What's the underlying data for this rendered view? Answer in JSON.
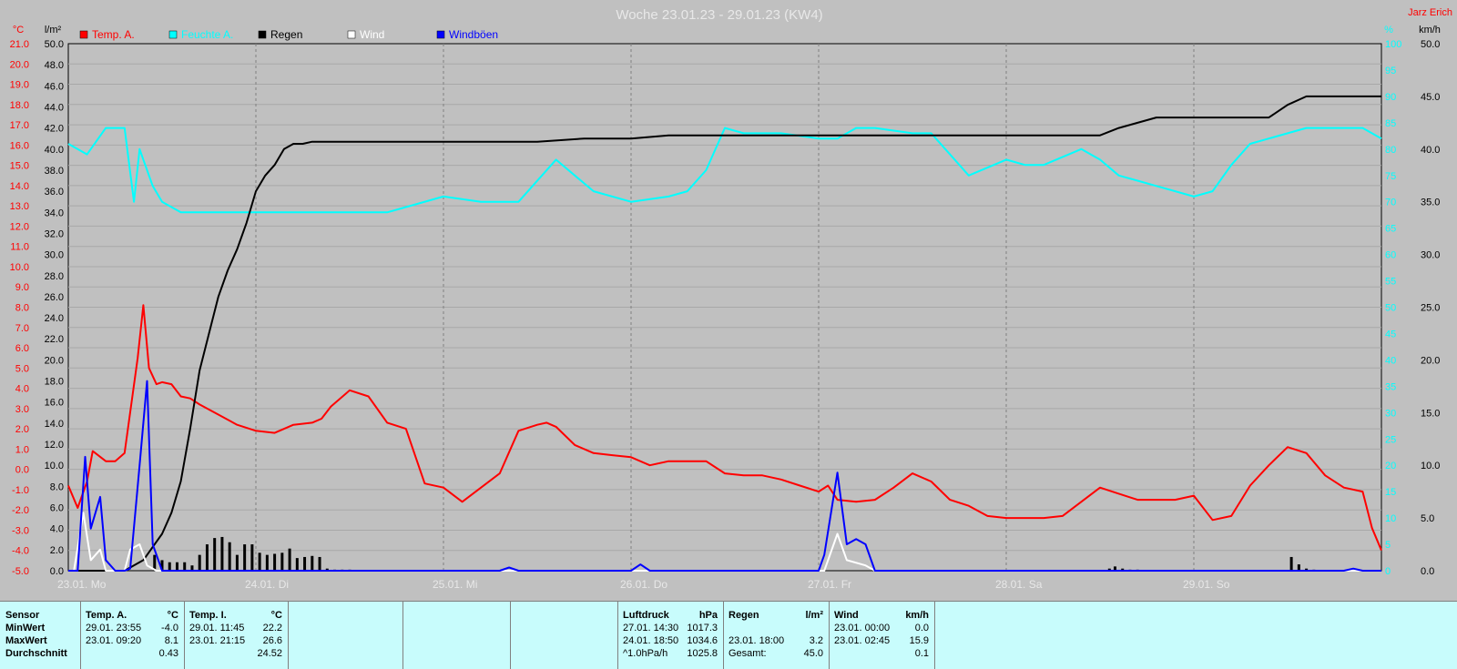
{
  "chart_data": {
    "type": "line",
    "title": "Woche 23.01.23 - 29.01.23 (KW4)",
    "author": "Jarz Erich",
    "axes": {
      "temp": {
        "unit": "°C",
        "range": [
          -5.0,
          21.0
        ],
        "ticks": [
          "21.0",
          "20.0",
          "19.0",
          "18.0",
          "17.0",
          "16.0",
          "15.0",
          "14.0",
          "13.0",
          "12.0",
          "11.0",
          "10.0",
          "9.0",
          "8.0",
          "7.0",
          "6.0",
          "5.0",
          "4.0",
          "3.0",
          "2.0",
          "1.0",
          "0.0",
          "-1.0",
          "-2.0",
          "-3.0",
          "-4.0",
          "-5.0"
        ],
        "color": "#ff0000"
      },
      "rain": {
        "unit": "l/m²",
        "range": [
          0.0,
          50.0
        ],
        "ticks": [
          "50.0",
          "48.0",
          "46.0",
          "44.0",
          "42.0",
          "40.0",
          "38.0",
          "36.0",
          "34.0",
          "32.0",
          "30.0",
          "28.0",
          "26.0",
          "24.0",
          "22.0",
          "20.0",
          "18.0",
          "16.0",
          "14.0",
          "12.0",
          "10.0",
          "8.0",
          "6.0",
          "4.0",
          "2.0",
          "0.0"
        ],
        "color": "#000000"
      },
      "humidity": {
        "unit": "%",
        "range": [
          0,
          100
        ],
        "ticks": [
          "100",
          "95",
          "90",
          "85",
          "80",
          "75",
          "70",
          "65",
          "60",
          "55",
          "50",
          "45",
          "40",
          "35",
          "30",
          "25",
          "20",
          "15",
          "10",
          "5",
          "0"
        ],
        "color": "#00ffff"
      },
      "wind": {
        "unit": "km/h",
        "range": [
          0.0,
          50.0
        ],
        "ticks": [
          "50.0",
          "45.0",
          "40.0",
          "35.0",
          "30.0",
          "25.0",
          "20.0",
          "15.0",
          "10.0",
          "5.0",
          "0.0"
        ],
        "color": "#000000"
      }
    },
    "x_range_days": [
      0,
      7
    ],
    "x_labels": [
      "23.01. Mo",
      "24.01. Di",
      "25.01. Mi",
      "26.01. Do",
      "27.01. Fr",
      "28.01. Sa",
      "29.01. So"
    ],
    "legend": [
      {
        "name": "Temp. A.",
        "color": "#ff0000"
      },
      {
        "name": "Feuchte A.",
        "color": "#00ffff"
      },
      {
        "name": "Regen",
        "color": "#000000"
      },
      {
        "name": "Wind",
        "color": "#ffffff"
      },
      {
        "name": "Windböen",
        "color": "#0000ff"
      }
    ],
    "grid": true,
    "series": [
      {
        "name": "Temp. A.",
        "axis": "temp",
        "color": "#ff0000",
        "x": [
          0.0,
          0.05,
          0.1,
          0.13,
          0.2,
          0.25,
          0.3,
          0.37,
          0.4,
          0.43,
          0.47,
          0.5,
          0.55,
          0.6,
          0.65,
          0.7,
          0.8,
          0.9,
          1.0,
          1.1,
          1.2,
          1.3,
          1.35,
          1.4,
          1.5,
          1.6,
          1.7,
          1.8,
          1.9,
          2.0,
          2.1,
          2.2,
          2.3,
          2.4,
          2.5,
          2.55,
          2.6,
          2.7,
          2.8,
          2.9,
          3.0,
          3.1,
          3.2,
          3.3,
          3.4,
          3.5,
          3.6,
          3.7,
          3.8,
          3.9,
          4.0,
          4.05,
          4.1,
          4.2,
          4.3,
          4.4,
          4.5,
          4.6,
          4.7,
          4.8,
          4.9,
          5.0,
          5.1,
          5.2,
          5.3,
          5.4,
          5.5,
          5.6,
          5.7,
          5.8,
          5.9,
          6.0,
          6.1,
          6.2,
          6.3,
          6.4,
          6.5,
          6.6,
          6.7,
          6.8,
          6.9,
          6.95,
          7.0
        ],
        "values": [
          -0.8,
          -1.9,
          -0.6,
          0.9,
          0.4,
          0.4,
          0.8,
          5.5,
          8.1,
          5.0,
          4.2,
          4.3,
          4.2,
          3.6,
          3.5,
          3.2,
          2.7,
          2.2,
          1.9,
          1.8,
          2.2,
          2.3,
          2.5,
          3.1,
          3.9,
          3.6,
          2.3,
          2.0,
          -0.7,
          -0.9,
          -1.6,
          -0.9,
          -0.2,
          1.9,
          2.2,
          2.3,
          2.1,
          1.2,
          0.8,
          0.7,
          0.6,
          0.2,
          0.4,
          0.4,
          0.4,
          -0.2,
          -0.3,
          -0.3,
          -0.5,
          -0.8,
          -1.1,
          -0.8,
          -1.5,
          -1.6,
          -1.5,
          -0.9,
          -0.2,
          -0.6,
          -1.5,
          -1.8,
          -2.3,
          -2.4,
          -2.4,
          -2.4,
          -2.3,
          -1.6,
          -0.9,
          -1.2,
          -1.5,
          -1.5,
          -1.5,
          -1.3,
          -2.5,
          -2.3,
          -0.8,
          0.2,
          1.1,
          0.8,
          -0.3,
          -0.9,
          -1.1,
          -2.9,
          -4.0
        ]
      },
      {
        "name": "Feuchte A.",
        "axis": "humidity",
        "color": "#00ffff",
        "x": [
          0.0,
          0.1,
          0.2,
          0.3,
          0.35,
          0.38,
          0.4,
          0.45,
          0.5,
          0.6,
          0.8,
          1.0,
          1.2,
          1.3,
          1.5,
          1.7,
          1.8,
          2.0,
          2.2,
          2.4,
          2.6,
          2.7,
          2.8,
          3.0,
          3.2,
          3.3,
          3.4,
          3.5,
          3.6,
          3.8,
          4.0,
          4.1,
          4.2,
          4.3,
          4.5,
          4.6,
          4.7,
          4.8,
          5.0,
          5.1,
          5.2,
          5.4,
          5.5,
          5.6,
          5.7,
          5.8,
          6.0,
          6.1,
          6.2,
          6.3,
          6.4,
          6.5,
          6.6,
          6.8,
          6.9,
          7.0
        ],
        "values": [
          81,
          79,
          84,
          84,
          70,
          80,
          78,
          73,
          70,
          68,
          68,
          68,
          68,
          68,
          68,
          68,
          69,
          71,
          70,
          70,
          78,
          75,
          72,
          70,
          71,
          72,
          76,
          84,
          83,
          83,
          82,
          82,
          84,
          84,
          83,
          83,
          79,
          75,
          78,
          77,
          77,
          80,
          78,
          75,
          74,
          73,
          71,
          72,
          77,
          81,
          82,
          83,
          84,
          84,
          84,
          82
        ]
      },
      {
        "name": "Regen",
        "axis": "rain",
        "color": "#000000",
        "x": [
          0.0,
          0.3,
          0.4,
          0.5,
          0.55,
          0.6,
          0.65,
          0.7,
          0.75,
          0.8,
          0.85,
          0.9,
          0.95,
          1.0,
          1.05,
          1.1,
          1.15,
          1.2,
          1.25,
          1.3,
          1.4,
          1.6,
          1.8,
          2.0,
          2.2,
          2.5,
          2.75,
          3.0,
          3.2,
          3.4,
          3.6,
          3.8,
          4.0,
          4.2,
          4.4,
          5.0,
          5.5,
          5.6,
          5.7,
          5.8,
          6.0,
          6.2,
          6.3,
          6.4,
          6.5,
          6.6,
          6.7,
          7.0
        ],
        "values": [
          0.0,
          0.0,
          1.0,
          3.5,
          5.5,
          8.5,
          13.5,
          19.0,
          22.5,
          26.0,
          28.5,
          30.5,
          33.0,
          36.0,
          37.5,
          38.5,
          40.0,
          40.5,
          40.5,
          40.7,
          40.7,
          40.7,
          40.7,
          40.7,
          40.7,
          40.7,
          41.0,
          41.0,
          41.3,
          41.3,
          41.3,
          41.3,
          41.3,
          41.3,
          41.3,
          41.3,
          41.3,
          42.0,
          42.5,
          43.0,
          43.0,
          43.0,
          43.0,
          43.0,
          44.2,
          45.0,
          45.0,
          45.0
        ]
      },
      {
        "name": "Wind",
        "axis": "wind",
        "color": "#ffffff",
        "x": [
          0.0,
          0.03,
          0.08,
          0.12,
          0.17,
          0.2,
          0.3,
          0.33,
          0.38,
          0.42,
          0.47,
          0.5,
          4.0,
          4.03,
          4.1,
          4.15,
          4.25,
          4.3,
          7.0
        ],
        "values": [
          0.0,
          0.0,
          5.5,
          1.0,
          2.0,
          0.0,
          0.0,
          2.0,
          2.5,
          0.5,
          0.0,
          0.0,
          0.0,
          0.0,
          3.5,
          1.0,
          0.5,
          0.0,
          0.0
        ]
      },
      {
        "name": "Windböen",
        "axis": "wind",
        "color": "#0000ff",
        "x": [
          0.0,
          0.05,
          0.09,
          0.12,
          0.17,
          0.2,
          0.25,
          0.3,
          0.33,
          0.38,
          0.42,
          0.45,
          0.5,
          2.3,
          2.35,
          2.4,
          3.0,
          3.05,
          3.1,
          4.0,
          4.03,
          4.1,
          4.15,
          4.2,
          4.25,
          4.3,
          4.4,
          6.8,
          6.85,
          6.9,
          7.0
        ],
        "values": [
          0.0,
          0.0,
          10.8,
          4.0,
          7.0,
          1.0,
          0.0,
          0.0,
          0.2,
          10.0,
          18.0,
          2.5,
          0.0,
          0.0,
          0.3,
          0.0,
          0.0,
          0.6,
          0.0,
          0.0,
          1.5,
          9.3,
          2.5,
          3.0,
          2.5,
          0.0,
          0.0,
          0.0,
          0.2,
          0.0,
          0.0
        ]
      },
      {
        "name": "Regen Menge",
        "axis": "rain",
        "color": "#000000",
        "kind": "bars",
        "x": [
          0.46,
          0.5,
          0.54,
          0.58,
          0.62,
          0.66,
          0.7,
          0.74,
          0.78,
          0.82,
          0.86,
          0.9,
          0.94,
          0.98,
          1.02,
          1.06,
          1.1,
          1.14,
          1.18,
          1.22,
          1.26,
          1.3,
          1.34,
          1.38,
          1.42,
          1.46,
          1.5,
          5.55,
          5.58,
          5.62,
          5.66,
          5.7,
          6.52,
          6.56,
          6.6,
          6.64
        ],
        "values": [
          1.5,
          1.0,
          0.8,
          0.8,
          0.8,
          0.5,
          1.5,
          2.5,
          3.1,
          3.2,
          2.7,
          1.5,
          2.5,
          2.5,
          1.7,
          1.5,
          1.6,
          1.7,
          2.1,
          1.2,
          1.3,
          1.4,
          1.3,
          0.2,
          0.1,
          0.1,
          0.1,
          0.2,
          0.4,
          0.2,
          0.1,
          0.1,
          1.3,
          0.6,
          0.2,
          0.1
        ]
      }
    ]
  },
  "stats": {
    "sensor": {
      "header": "Sensor",
      "min": "MinWert",
      "max": "MaxWert",
      "avg": "Durchschnitt"
    },
    "temp_a": {
      "header": "Temp. A.",
      "unit": "°C",
      "min_time": "29.01.  23:55",
      "min_val": "-4.0",
      "max_time": "23.01.  09:20",
      "max_val": "8.1",
      "avg_val": "0.43"
    },
    "temp_i": {
      "header": "Temp. I.",
      "unit": "°C",
      "min_time": "29.01.  11:45",
      "min_val": "22.2",
      "max_time": "23.01.  21:15",
      "max_val": "26.6",
      "avg_val": "24.52"
    },
    "pressure": {
      "header": "Luftdruck",
      "unit": "hPa",
      "min_time": "27.01.  14:30",
      "min_val": "1017.3",
      "max_time": "24.01.  18:50",
      "max_val": "1034.6",
      "avg_label": "^1.0hPa/h",
      "avg_val": "1025.8"
    },
    "rain": {
      "header": "Regen",
      "unit": "l/m²",
      "max_time": "23.01.  18:00",
      "max_val": "3.2",
      "total_label": "Gesamt:",
      "total_val": "45.0"
    },
    "wind": {
      "header": "Wind",
      "unit": "km/h",
      "min_time": "23.01.  00:00",
      "min_val": "0.0",
      "max_time": "23.01.  02:45",
      "max_val": "15.9",
      "avg_val": "0.1"
    }
  }
}
